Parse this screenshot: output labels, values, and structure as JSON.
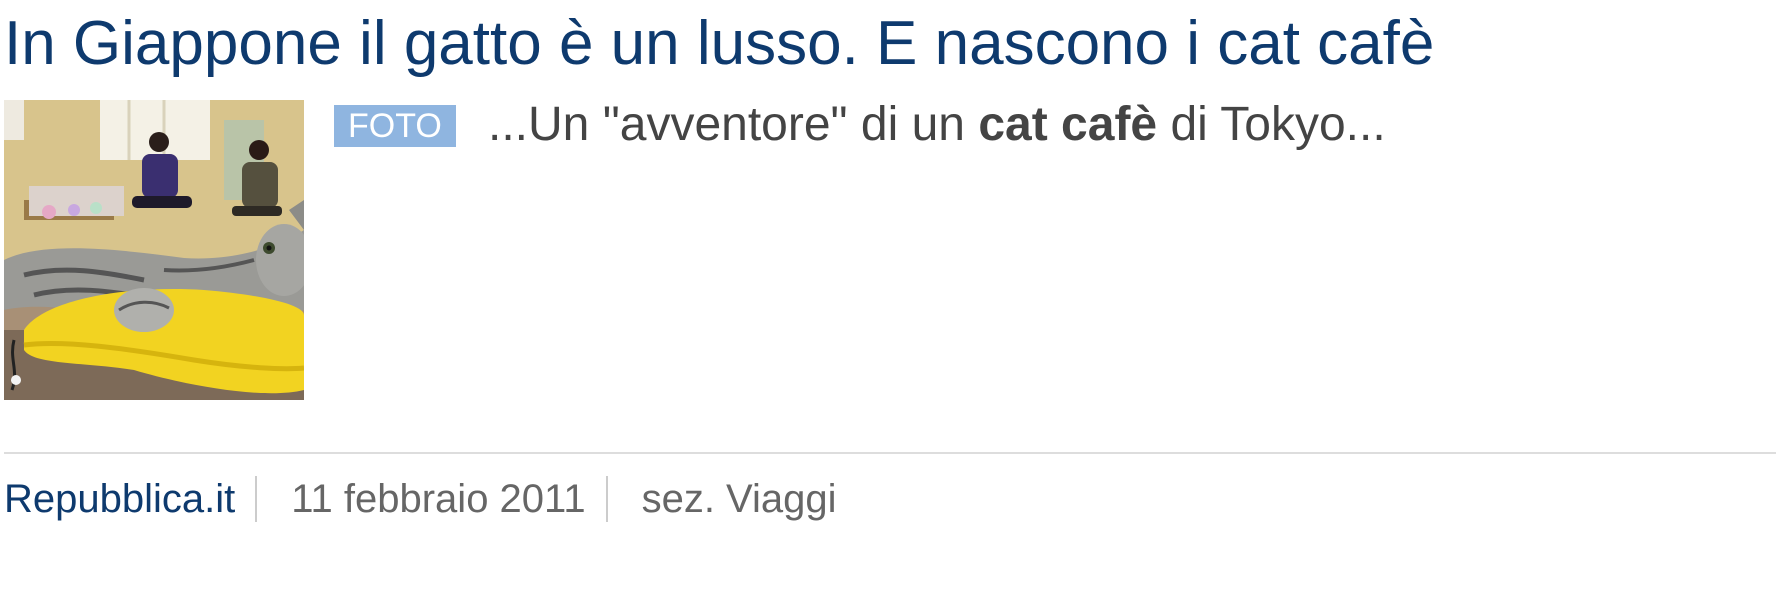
{
  "article": {
    "title": "In Giappone il gatto è un lusso. E nascono i cat cafè",
    "badge": "FOTO",
    "snippet": {
      "before": "...Un \"avventore\" di un ",
      "highlight": "cat cafè",
      "after": " di Tokyo..."
    },
    "thumbnail_icon": "photo-cat-on-yellow-cushion"
  },
  "meta": {
    "source": "Repubblica.it",
    "date": "11 febbraio 2011",
    "section": "sez. Viaggi"
  },
  "colors": {
    "title": "#0e3a6e",
    "badge_bg": "#8fb5e0",
    "text": "#444444",
    "meta_text": "#666666",
    "divider": "#dddddd"
  }
}
